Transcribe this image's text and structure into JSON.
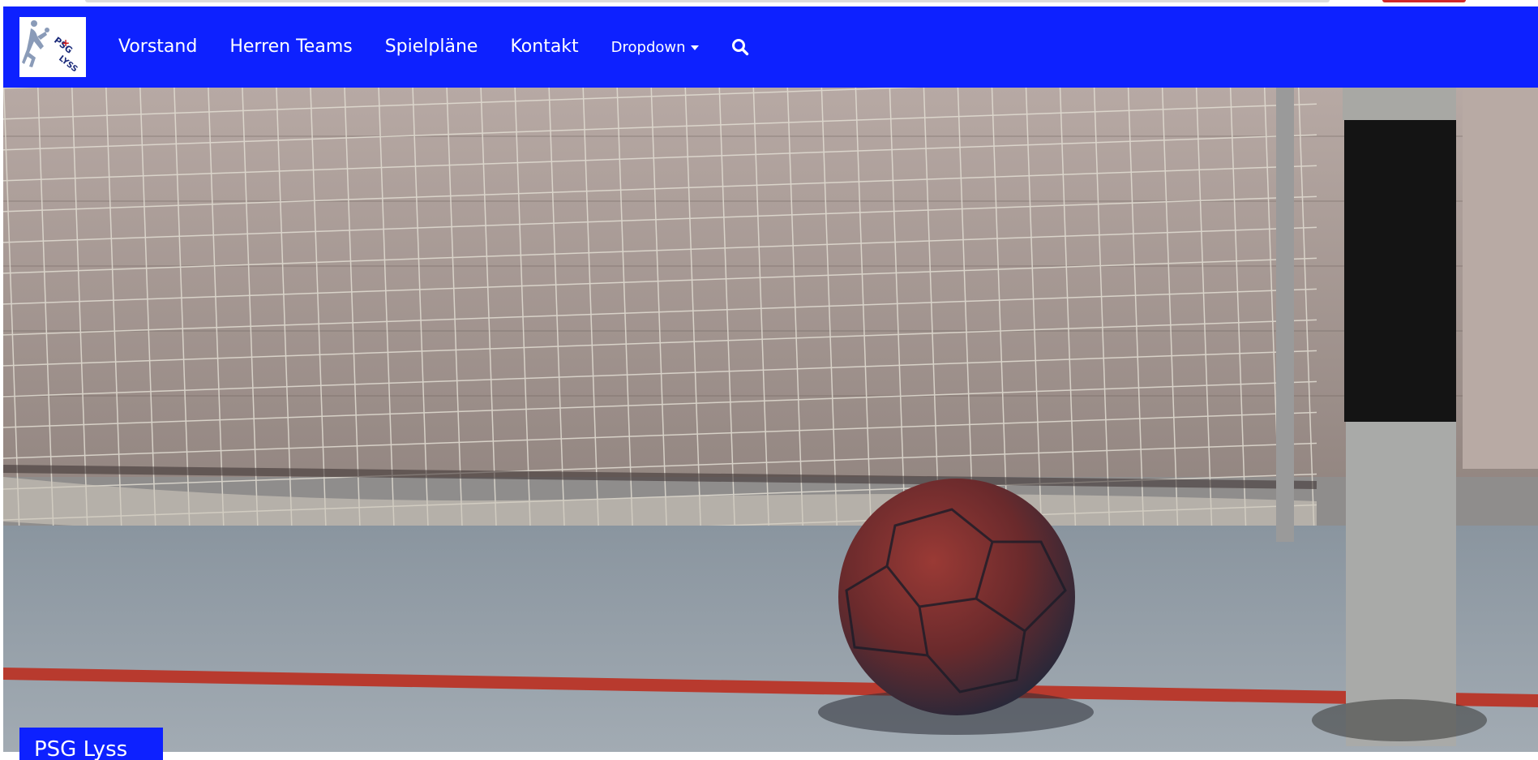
{
  "nav": {
    "logo_alt": "PSG Lyss",
    "logo_text_top": "PSG",
    "logo_text_bottom": "LYSS",
    "links": [
      {
        "label": "Vorstand"
      },
      {
        "label": "Herren Teams"
      },
      {
        "label": "Spielpläne"
      },
      {
        "label": "Kontakt"
      }
    ],
    "dropdown_label": "Dropdown",
    "search_icon": "search-icon"
  },
  "hero": {
    "image_description": "handball in front of goal net",
    "badge_text": "PSG Lyss"
  },
  "colors": {
    "nav_bg": "#0d21ff",
    "nav_text": "#ffffff",
    "badge_bg": "#0d21ff"
  }
}
